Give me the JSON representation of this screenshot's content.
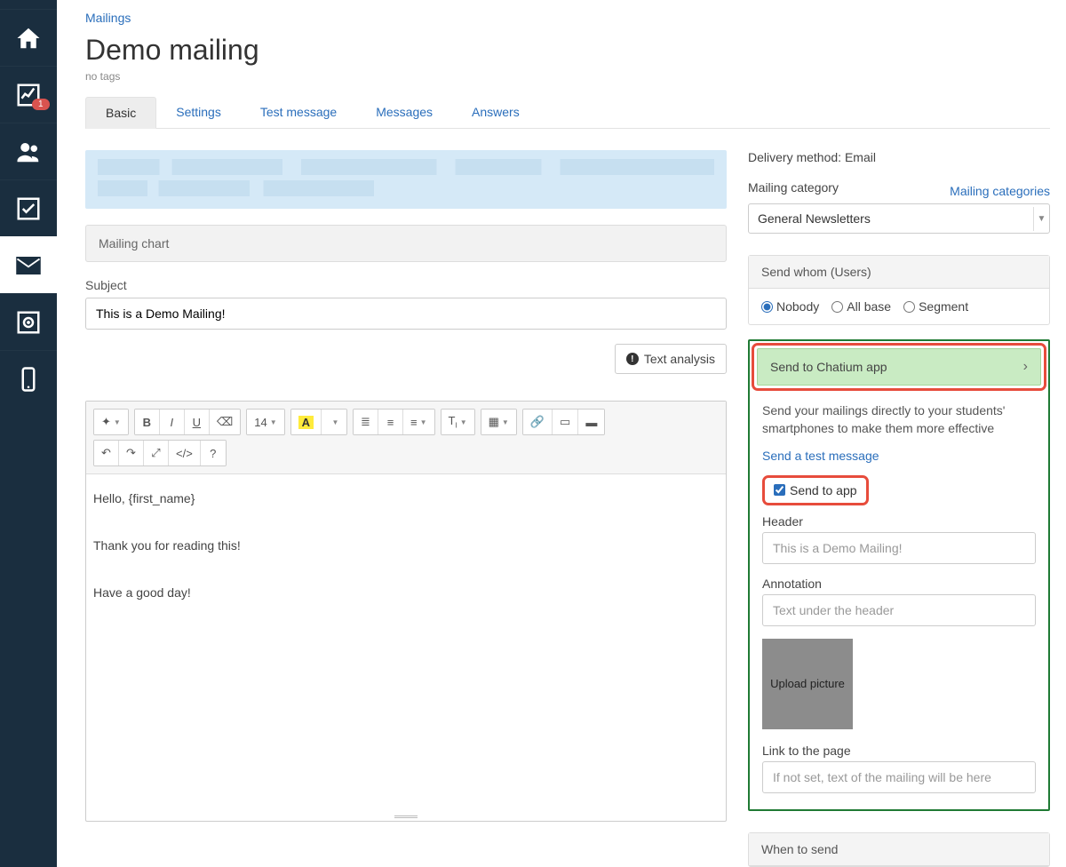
{
  "sidebar": {
    "badge_count": "1"
  },
  "breadcrumb": {
    "label": "Mailings"
  },
  "page": {
    "title": "Demo mailing",
    "tags": "no tags"
  },
  "tabs": {
    "basic": "Basic",
    "settings": "Settings",
    "test_message": "Test message",
    "messages": "Messages",
    "answers": "Answers"
  },
  "left": {
    "mailing_chart": "Mailing chart",
    "subject_label": "Subject",
    "subject_value": "This is a Demo Mailing!",
    "text_analysis_btn": "Text analysis",
    "editor": {
      "font_size": "14",
      "font_letter": "A",
      "body_line1": "Hello, {first_name}",
      "body_line2": "Thank you for reading this!",
      "body_line3": "Have a good day!"
    }
  },
  "right": {
    "delivery_method_label": "Delivery method: ",
    "delivery_method_value": "Email",
    "mailing_category_label": "Mailing category",
    "mailing_categories_link": "Mailing categories",
    "category_selected": "General Newsletters",
    "send_whom_header": "Send whom (Users)",
    "radio_nobody": "Nobody",
    "radio_allbase": "All base",
    "radio_segment": "Segment",
    "chatium": {
      "header": "Send to Chatium app",
      "desc": "Send your mailings directly to your students' smartphones to make them more effective",
      "send_test_link": "Send a test message",
      "checkbox_label": "Send to app",
      "header_label": "Header",
      "header_placeholder": "This is a Demo Mailing!",
      "annotation_label": "Annotation",
      "annotation_placeholder": "Text under the header",
      "upload_label": "Upload picture",
      "link_label": "Link to the page",
      "link_placeholder": "If not set, text of the mailing will be here"
    },
    "when_to_send": "When to send"
  }
}
